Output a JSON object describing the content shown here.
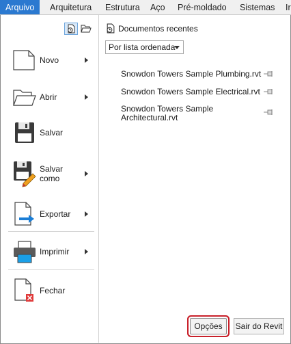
{
  "tabs": [
    {
      "label": "Arquivo",
      "active": true
    },
    {
      "label": "Arquitetura"
    },
    {
      "label": "Estrutura"
    },
    {
      "label": "Aço"
    },
    {
      "label": "Pré-moldado"
    },
    {
      "label": "Sistemas"
    },
    {
      "label": "Ir"
    }
  ],
  "view_toggles": {
    "recent_icon": "recent-docs-icon",
    "open_icon": "open-docs-icon"
  },
  "menu": {
    "novo": "Novo",
    "abrir": "Abrir",
    "salvar": "Salvar",
    "salvar_como": "Salvar como",
    "exportar": "Exportar",
    "imprimir": "Imprimir",
    "fechar": "Fechar"
  },
  "recent": {
    "title": "Documentos recentes",
    "sort_value": "Por lista ordenada",
    "documents": [
      {
        "name": "Snowdon Towers Sample Plumbing.rvt"
      },
      {
        "name": "Snowdon Towers Sample Electrical.rvt"
      },
      {
        "name": "Snowdon Towers Sample Architectural.rvt"
      }
    ]
  },
  "buttons": {
    "options": "Opções",
    "exit": "Sair do Revit"
  },
  "colors": {
    "accent": "#2b79d0",
    "highlight": "#c8202a"
  }
}
